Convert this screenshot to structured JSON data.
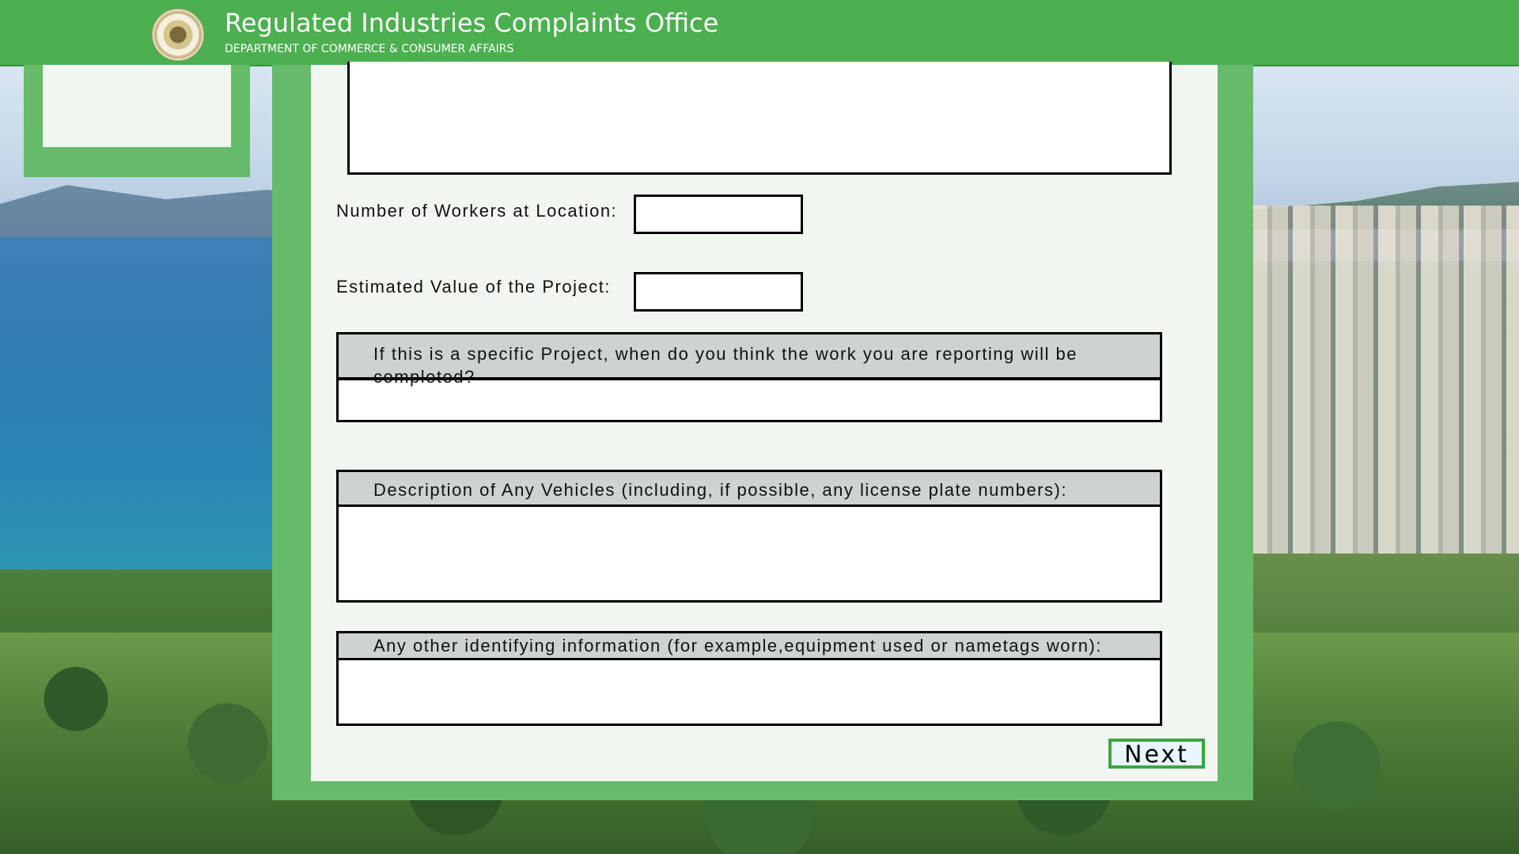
{
  "header": {
    "title": "Regulated Industries Complaints Office",
    "subtitle": "DEPARTMENT OF COMMERCE & CONSUMER AFFAIRS",
    "seal_icon": "state-seal-icon"
  },
  "form": {
    "workers_label": "Number of Workers at Location:",
    "workers_value": "",
    "project_value_label": "Estimated Value of the Project:",
    "project_value": "",
    "completion_label": "If this is a specific Project, when do you think the work you are reporting will be completed?",
    "completion_value": "",
    "vehicles_label": "Description of Any Vehicles (including, if possible, any license plate numbers):",
    "vehicles_value": "",
    "other_info_label": "Any other identifying information (for example,equipment used or nametags worn):",
    "other_info_value": "",
    "next_label": "Next"
  },
  "colors": {
    "header_green": "#4caf50",
    "panel_green": "#66bb6a",
    "form_background": "#f1f6f1",
    "section_header_gray": "#cdd2d2",
    "next_border_green": "#3da542"
  }
}
